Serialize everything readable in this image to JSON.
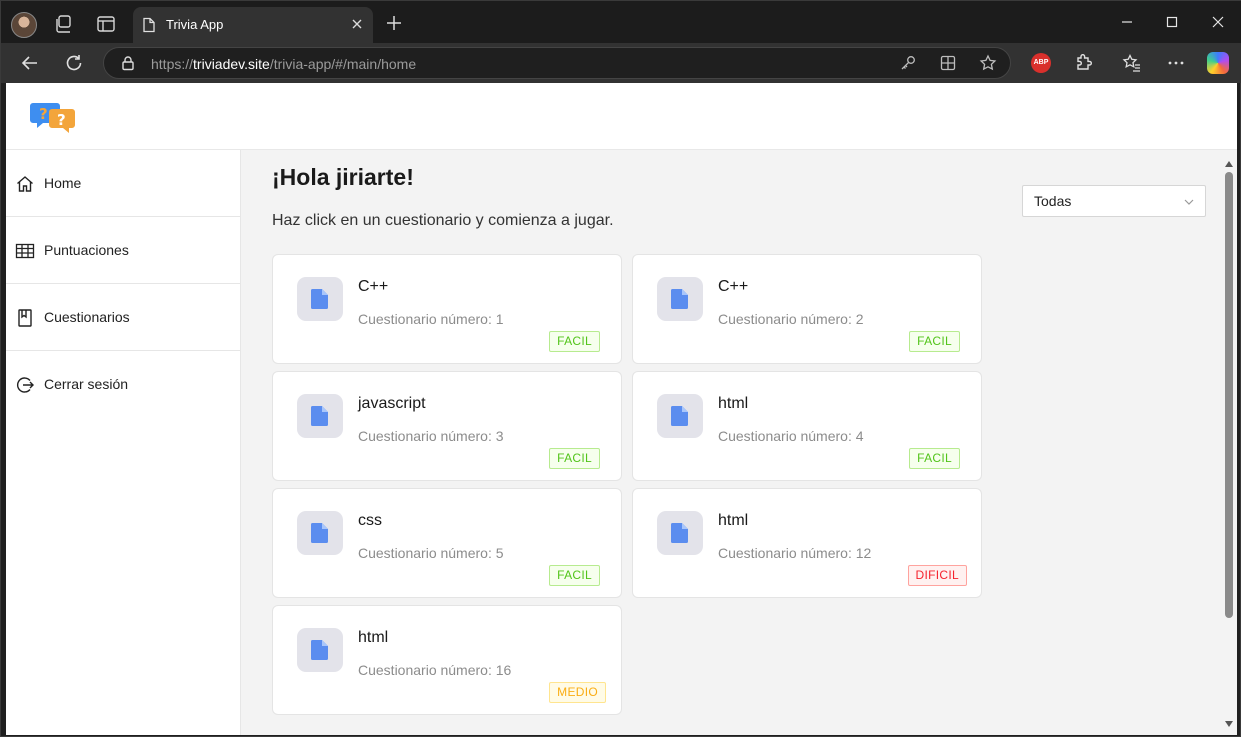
{
  "browser": {
    "tab_title": "Trivia App",
    "url_scheme": "https://",
    "url_host": "triviadev.site",
    "url_path": "/trivia-app/#/main/home",
    "adblock_label": "ABP"
  },
  "sidebar": {
    "items": [
      {
        "label": "Home",
        "icon": "home-icon"
      },
      {
        "label": "Puntuaciones",
        "icon": "table-icon"
      },
      {
        "label": "Cuestionarios",
        "icon": "book-icon"
      },
      {
        "label": "Cerrar sesión",
        "icon": "logout-icon"
      }
    ]
  },
  "main": {
    "greeting": "¡Hola jiriarte!",
    "subtitle": "Haz click en un cuestionario y comienza a jugar.",
    "filter": {
      "selected": "Todas"
    }
  },
  "quizzes": [
    {
      "title": "C++",
      "subtitle": "Cuestionario número: 1",
      "difficulty": "FACIL"
    },
    {
      "title": "C++",
      "subtitle": "Cuestionario número: 2",
      "difficulty": "FACIL"
    },
    {
      "title": "javascript",
      "subtitle": "Cuestionario número: 3",
      "difficulty": "FACIL"
    },
    {
      "title": "html",
      "subtitle": "Cuestionario número: 4",
      "difficulty": "FACIL"
    },
    {
      "title": "css",
      "subtitle": "Cuestionario número: 5",
      "difficulty": "FACIL"
    },
    {
      "title": "html",
      "subtitle": "Cuestionario número: 12",
      "difficulty": "DIFICIL"
    },
    {
      "title": "html",
      "subtitle": "Cuestionario número: 16",
      "difficulty": "MEDIO"
    }
  ],
  "colors": {
    "file_icon": "#5b8def",
    "facil": "#52c41a",
    "dificil": "#f5222d",
    "medio": "#faad14"
  }
}
